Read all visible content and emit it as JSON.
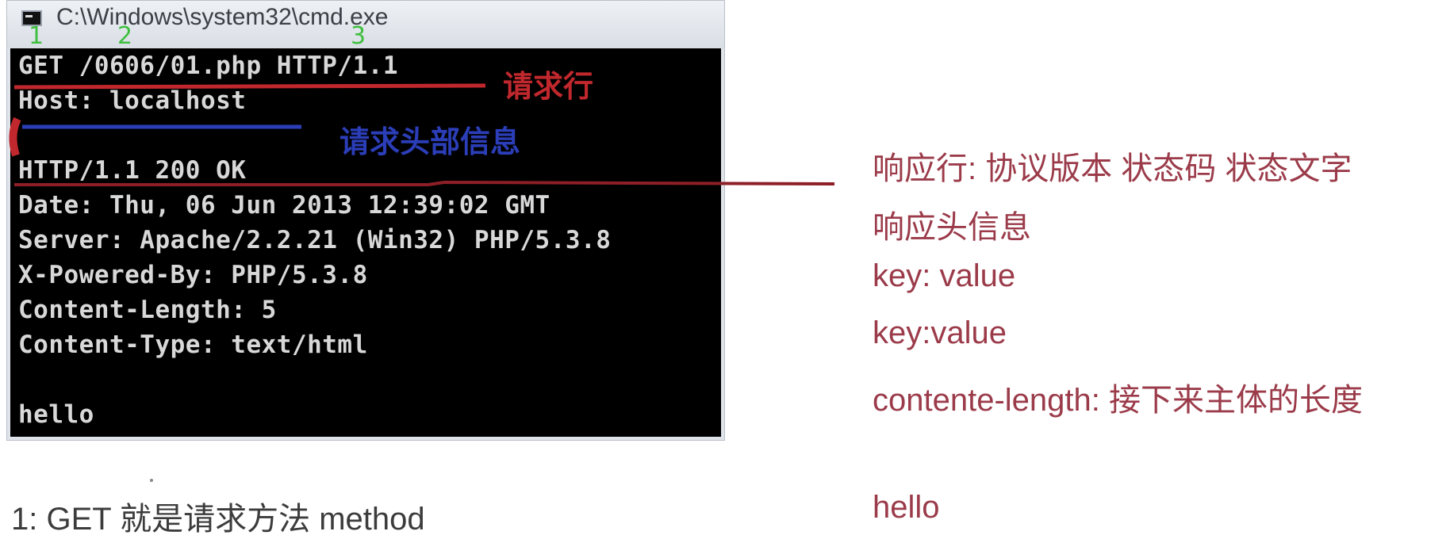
{
  "window": {
    "title": "C:\\Windows\\system32\\cmd.exe"
  },
  "console": {
    "lines": [
      "GET /0606/01.php HTTP/1.1",
      "Host: localhost",
      "",
      "HTTP/1.1 200 OK",
      "Date: Thu, 06 Jun 2013 12:39:02 GMT",
      "Server: Apache/2.2.21 (Win32) PHP/5.3.8",
      "X-Powered-By: PHP/5.3.8",
      "Content-Length: 5",
      "Content-Type: text/html",
      "",
      "hello"
    ]
  },
  "annotations": {
    "request_line": "请求行",
    "request_headers": "请求头部信息",
    "markers": [
      "1",
      "2",
      "3"
    ]
  },
  "notes": {
    "response_line": "响应行: 协议版本 状态码 状态文字",
    "response_headers": "响应头信息",
    "kv1": "key: value",
    "kv2": "key:value",
    "content_length": "contente-length: 接下来主体的长度",
    "hello": "hello"
  },
  "bottom_note": "1: GET 就是请求方法 method",
  "colors": {
    "annotation_red": "#c0282d",
    "annotation_blue": "#2b3eb8",
    "note_text": "#9b3b4a"
  }
}
